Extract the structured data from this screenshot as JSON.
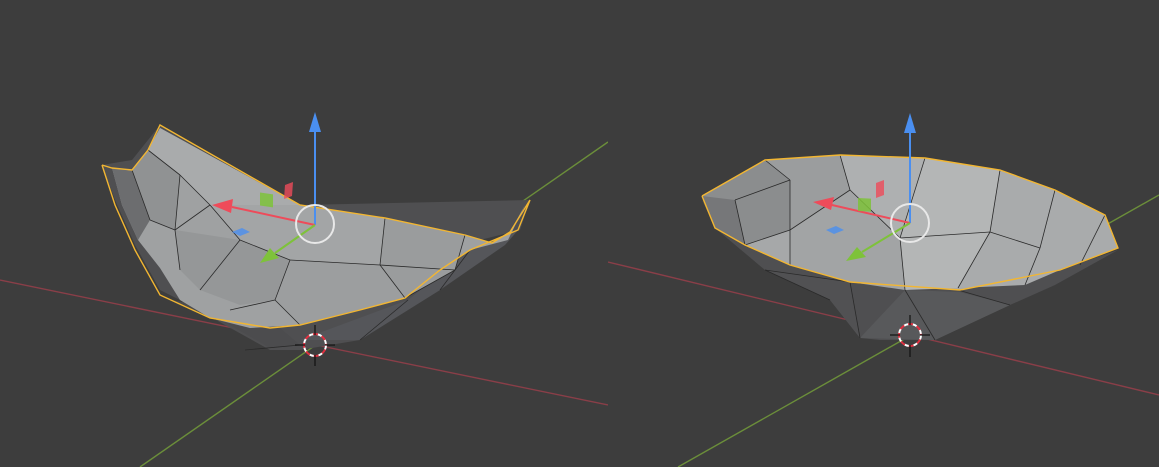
{
  "app": {
    "background_color": "#3d3d3d",
    "theme": "blender-3d-viewport"
  },
  "viewports": [
    {
      "id": "left",
      "object": "curved-bowl-mesh",
      "selected": true
    },
    {
      "id": "right",
      "object": "round-bowl-mesh",
      "selected": true
    }
  ],
  "colors": {
    "x_axis": "#8a3e48",
    "y_axis": "#6b8e3a",
    "selection_outline": "#f2b632",
    "gizmo_x": "#ee4b5a",
    "gizmo_y": "#7ec23a",
    "gizmo_z": "#4a8ff0",
    "cursor_red": "#e03040",
    "cursor_white": "#ffffff",
    "mesh_light": "#a7a9a9",
    "mesh_mid": "#8e8f90",
    "mesh_dark": "#4f4f51"
  },
  "icons": [
    "move-gizmo-icon",
    "3d-cursor-icon",
    "scale-plane-handle-icon"
  ]
}
